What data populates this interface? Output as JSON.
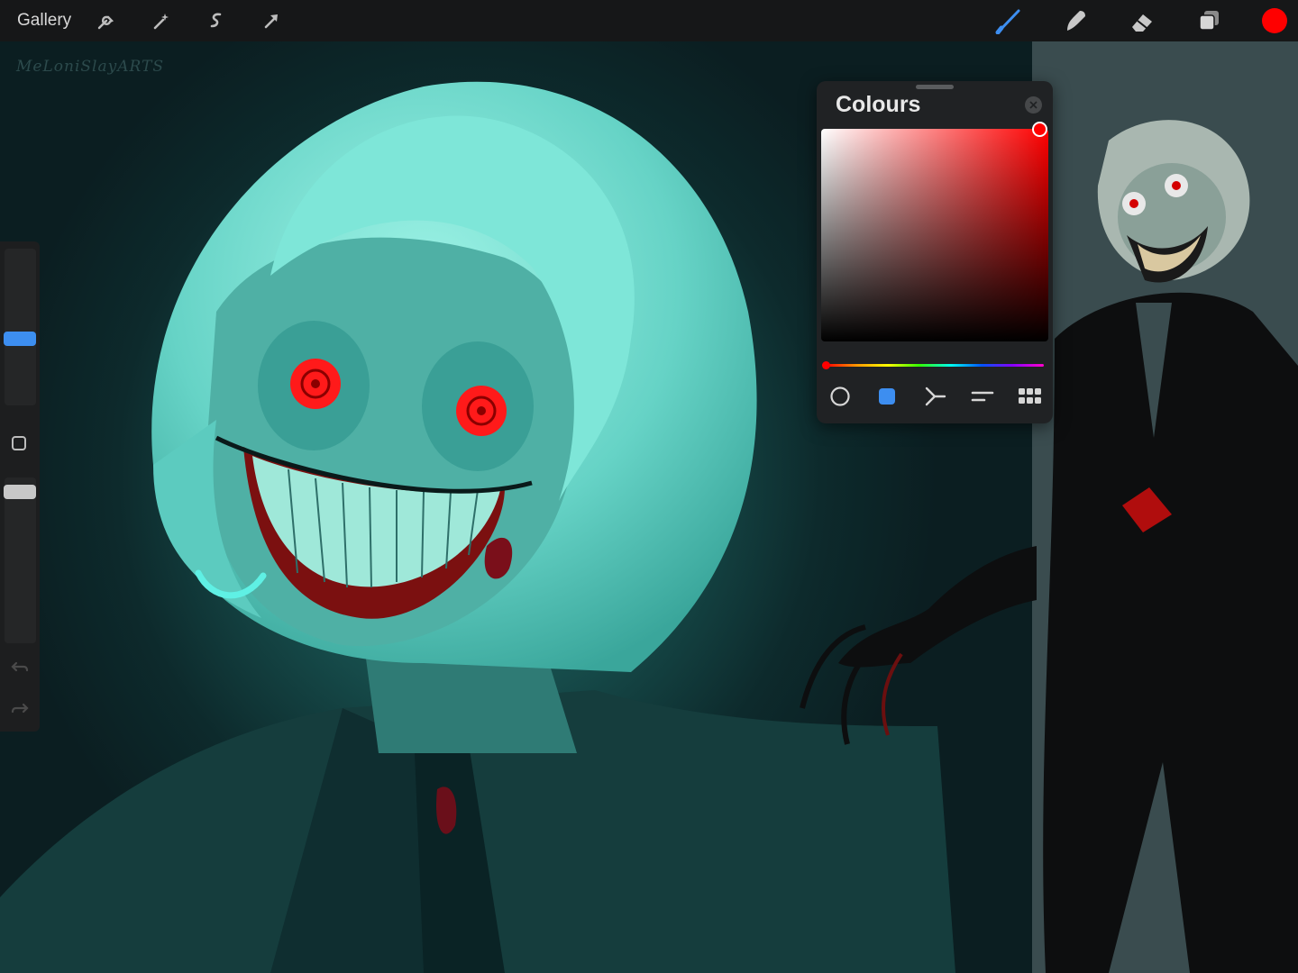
{
  "toolbar": {
    "gallery_label": "Gallery",
    "left_tools": [
      "wrench-icon",
      "magic-wand-icon",
      "selection-icon",
      "transform-arrow-icon"
    ],
    "right_tools": [
      "brush-icon",
      "smudge-icon",
      "eraser-icon",
      "layers-icon"
    ],
    "active_tool": "brush-icon",
    "current_color": "#ff0000"
  },
  "canvas": {
    "signature": "MeLoniSlayARTS",
    "artwork": "illustration of a grinning teal-haired character with red eyes"
  },
  "sidebar": {
    "brush_size_thumb_color": "#3d8ef0",
    "opacity_thumb_color": "#c8c8c8",
    "modify_button": "square-icon",
    "undo": "undo-icon",
    "redo": "redo-icon"
  },
  "colours_panel": {
    "title": "Colours",
    "selected_color": "#ff0000",
    "hue_position": 0,
    "modes": [
      "disc-icon",
      "classic-icon",
      "harmony-icon",
      "value-icon",
      "palettes-icon"
    ],
    "active_mode": "classic-icon"
  }
}
